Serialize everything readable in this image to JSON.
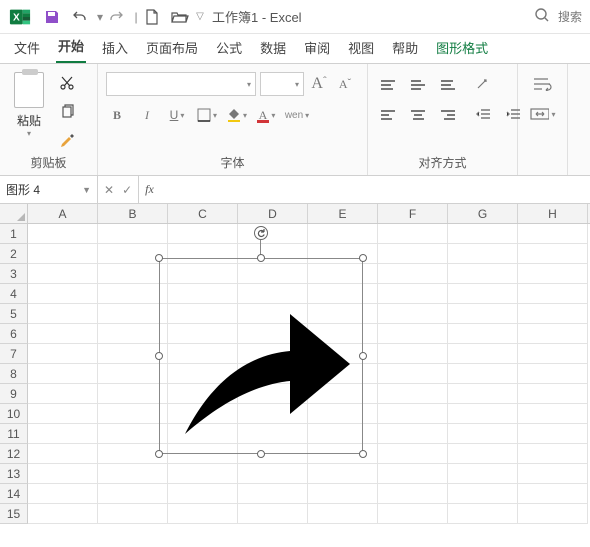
{
  "titlebar": {
    "doc_title": "工作簿1 - Excel",
    "search_placeholder": "搜索"
  },
  "tabs": {
    "file": "文件",
    "home": "开始",
    "insert": "插入",
    "layout": "页面布局",
    "formulas": "公式",
    "data": "数据",
    "review": "审阅",
    "view": "视图",
    "help": "帮助",
    "shape_format": "图形格式"
  },
  "ribbon": {
    "clipboard": {
      "paste": "粘贴",
      "group": "剪贴板"
    },
    "font": {
      "group": "字体",
      "buttons": {
        "b": "B",
        "i": "I",
        "u": "U",
        "wen": "wen"
      }
    },
    "align": {
      "group": "对齐方式"
    }
  },
  "namebox": {
    "value": "图形 4"
  },
  "fx": {
    "label": "fx"
  },
  "cols": [
    "A",
    "B",
    "C",
    "D",
    "E",
    "F",
    "G",
    "H"
  ],
  "rows": [
    "1",
    "2",
    "3",
    "4",
    "5",
    "6",
    "7",
    "8",
    "9",
    "10",
    "11",
    "12",
    "13",
    "14",
    "15"
  ]
}
